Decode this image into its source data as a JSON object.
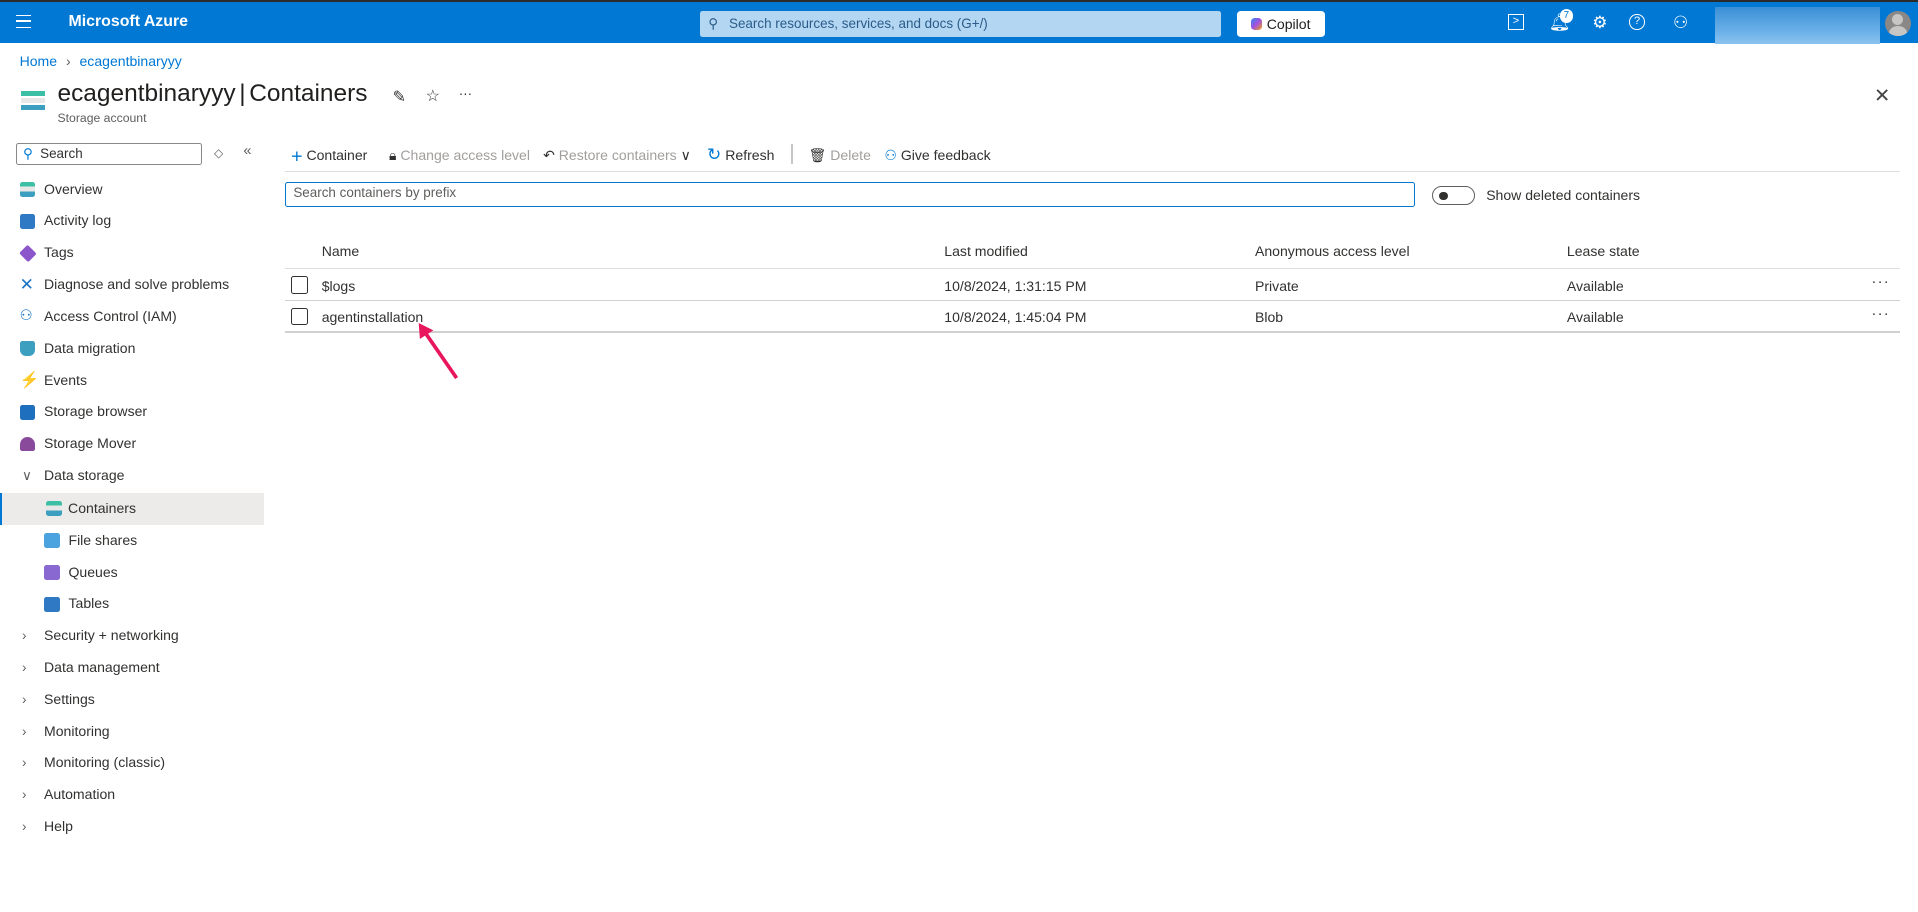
{
  "topbar": {
    "brand": "Microsoft Azure",
    "search_placeholder": "Search resources, services, and docs (G+/)",
    "copilot_label": "Copilot",
    "notification_count": "7",
    "icons": [
      "cloud-shell-icon",
      "notifications-icon",
      "settings-icon",
      "help-icon",
      "feedback-icon"
    ],
    "color": "#0078d4"
  },
  "breadcrumb": {
    "home": "Home",
    "resource": "ecagentbinaryyy"
  },
  "header": {
    "resource_name": "ecagentbinaryyy",
    "separator": "|",
    "page": "Containers",
    "subtitle": "Storage account",
    "more": "···"
  },
  "sidebar": {
    "search_placeholder": "Search",
    "items": [
      {
        "label": "Overview"
      },
      {
        "label": "Activity log"
      },
      {
        "label": "Tags"
      },
      {
        "label": "Diagnose and solve problems"
      },
      {
        "label": "Access Control (IAM)"
      },
      {
        "label": "Data migration"
      },
      {
        "label": "Events"
      },
      {
        "label": "Storage browser"
      },
      {
        "label": "Storage Mover"
      }
    ],
    "data_storage": {
      "label": "Data storage",
      "children": [
        "Containers",
        "File shares",
        "Queues",
        "Tables"
      ]
    },
    "groups": [
      "Security + networking",
      "Data management",
      "Settings",
      "Monitoring",
      "Monitoring (classic)",
      "Automation",
      "Help"
    ]
  },
  "toolbar": {
    "container": "Container",
    "change_access": "Change access level",
    "restore": "Restore containers",
    "refresh": "Refresh",
    "delete": "Delete",
    "feedback": "Give feedback"
  },
  "filter": {
    "placeholder": "Search containers by prefix",
    "toggle_label": "Show deleted containers",
    "toggle_on": false
  },
  "table": {
    "headers": [
      "Name",
      "Last modified",
      "Anonymous access level",
      "Lease state"
    ],
    "rows": [
      {
        "name": "$logs",
        "modified": "10/8/2024, 1:31:15 PM",
        "access": "Private",
        "lease": "Available"
      },
      {
        "name": "agentinstallation",
        "modified": "10/8/2024, 1:45:04 PM",
        "access": "Blob",
        "lease": "Available"
      }
    ],
    "row_menu": "···"
  },
  "annotation_color": "#e8175d"
}
